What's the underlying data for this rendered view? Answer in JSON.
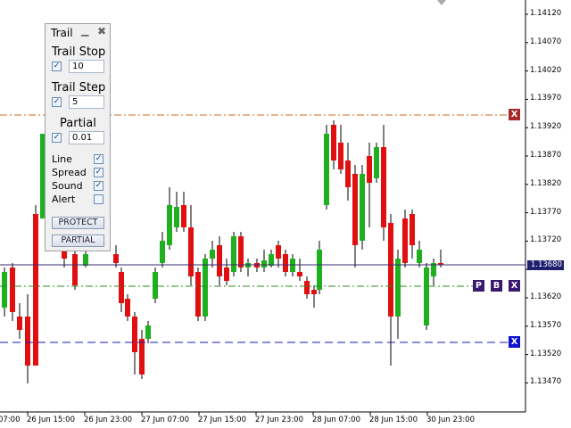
{
  "panel": {
    "title": "Trail",
    "minimize_icon": "minimize-icon",
    "close_icon": "close-icon",
    "trail_stop": {
      "label": "Trail Stop",
      "value": "10",
      "checked": true
    },
    "trail_step": {
      "label": "Trail Step",
      "value": "5",
      "checked": true
    },
    "partial": {
      "label": "Partial",
      "value": "0.01",
      "checked": true
    },
    "options": [
      {
        "label": "Line",
        "checked": true
      },
      {
        "label": "Spread",
        "checked": true
      },
      {
        "label": "Sound",
        "checked": true
      },
      {
        "label": "Alert",
        "checked": false
      }
    ],
    "protect_button": "PROTECT",
    "partial_button": "PARTIAL"
  },
  "price_axis": {
    "labels": [
      "1.14120",
      "1.14070",
      "1.14020",
      "1.13970",
      "1.13920",
      "1.13870",
      "1.13820",
      "1.13770",
      "1.13720",
      "1.13670",
      "1.13620",
      "1.13570",
      "1.13520",
      "1.13470"
    ],
    "current_price": "1.13680"
  },
  "time_axis": {
    "labels": [
      "07:00",
      "26 Jun 15:00",
      "26 Jun 23:00",
      "27 Jun 07:00",
      "27 Jun 15:00",
      "27 Jun 23:00",
      "28 Jun 07:00",
      "28 Jun 15:00",
      "30 Jun 23:00"
    ]
  },
  "lines": {
    "upper_marker": "X",
    "pending_markers": [
      "P",
      "B",
      "X"
    ],
    "lower_marker": "X",
    "colors": {
      "upper": "#d2691e",
      "pending": "#2e8b22",
      "lower": "#1a1ab4",
      "bid": "#3a2a6e"
    }
  },
  "colors": {
    "bull": "#1fb01f",
    "bear": "#e01010"
  }
}
